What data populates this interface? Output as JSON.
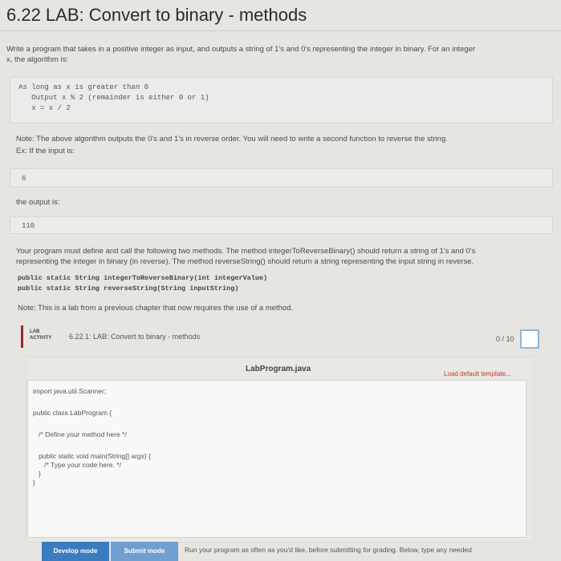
{
  "title": "6.22 LAB: Convert to binary - methods",
  "intro_line1": "Write a program that takes in a positive integer as input, and outputs a string of 1's and 0's representing the integer in binary. For an integer",
  "intro_line2": "x, the algorithm is:",
  "algorithm": {
    "line1": "As long as x is greater than 0",
    "line2": "   Output x % 2 (remainder is either 0 or 1)",
    "line3": "   x = x / 2"
  },
  "note1": "Note: The above algorithm outputs the 0's and 1's in reverse order. You will need to write a second function to reverse the string.",
  "example_intro": "Ex: If the input is:",
  "example_input": "6",
  "output_intro": "the output is:",
  "example_output": "110",
  "methods_line1": "Your program must define and call the following two methods. The method integerToReverseBinary() should return a string of 1's and 0's",
  "methods_line2": "representing the integer in binary (in reverse). The method reverseString() should return a string representing the input string in reverse.",
  "signatures": {
    "sig1": "public static String integerToReverseBinary(int integerValue)",
    "sig2": "public static String reverseString(String inputString)"
  },
  "note2": "Note: This is a lab from a previous chapter that now requires the use of a method.",
  "lab": {
    "tag_line1": "LAB",
    "tag_line2": "ACTIVITY",
    "title": "6.22.1: LAB: Convert to binary - methods",
    "score": "0 / 10"
  },
  "editor": {
    "filename": "LabProgram.java",
    "load_template": "Load default template...",
    "code": {
      "l1": "import java.util.Scanner;",
      "l2": "public class LabProgram {",
      "l3": "   /* Define your method here */",
      "l4": "   public static void main(String[] args) {",
      "l5": "      /* Type your code here. */",
      "l6": "   }",
      "l7": "}"
    }
  },
  "footer": {
    "develop_mode": "Develop mode",
    "submit_mode": "Submit mode",
    "run_text": "Run your program as often as you'd like, before submitting for grading. Below, type any needed"
  },
  "colors": {
    "accent_red": "#9c2a2a",
    "develop_btn": "#3b7bbf",
    "submit_btn": "#6f9fcf",
    "score_box": "#8fb6d8"
  }
}
